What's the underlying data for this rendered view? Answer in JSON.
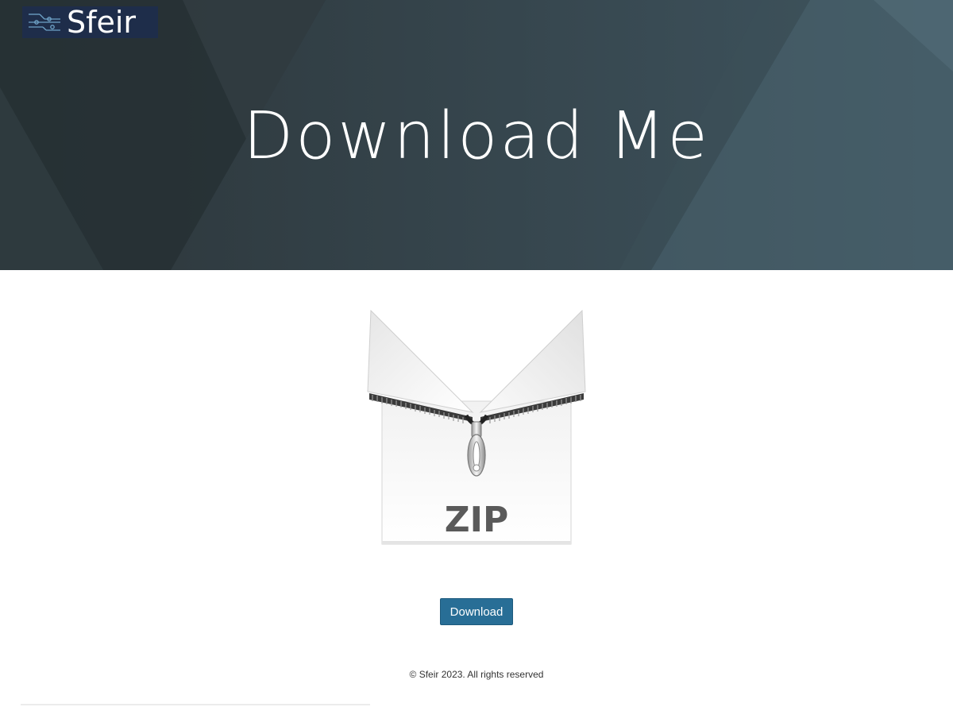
{
  "brand": {
    "name": "Sfeir",
    "logo_icon": "circuit-lines-icon",
    "logo_bg": "#1e2d4a"
  },
  "hero": {
    "title": "Download Me",
    "bg_color": "#2f3a3f"
  },
  "file": {
    "icon": "zip-file-icon",
    "label": "ZIP"
  },
  "actions": {
    "download_label": "Download",
    "button_color": "#286e96"
  },
  "footer": {
    "copyright": "© Sfeir 2023. All rights reserved"
  }
}
